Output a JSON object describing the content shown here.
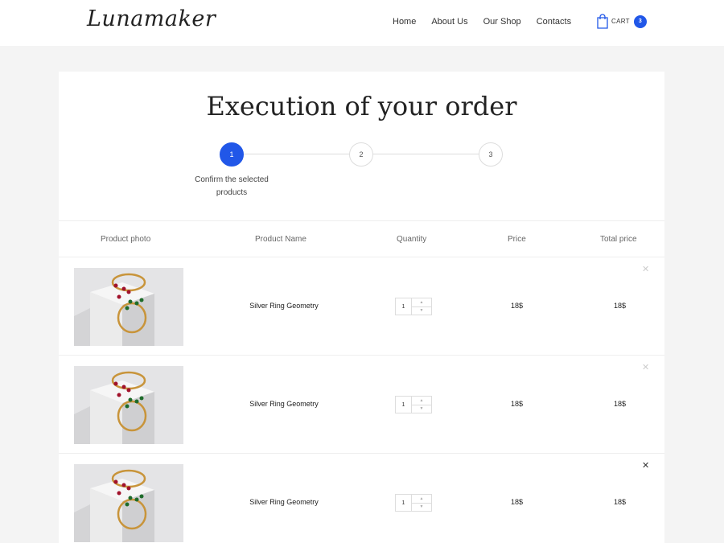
{
  "brand": {
    "logo": "Lunamaker"
  },
  "nav": {
    "items": [
      "Home",
      "About Us",
      "Our Shop",
      "Contacts"
    ]
  },
  "cart": {
    "label": "CART",
    "count": "3",
    "icon": "shopping-bag-icon"
  },
  "colors": {
    "accent": "#2157e8"
  },
  "page": {
    "title": "Execution of your order"
  },
  "steps": {
    "items": [
      "1",
      "2",
      "3"
    ],
    "active": 1,
    "caption_line1": "Confirm the selected",
    "caption_line2": "products"
  },
  "table": {
    "headers": [
      "Product photo",
      "Product Name",
      "Quantity",
      "Price",
      "Total price"
    ],
    "rows": [
      {
        "name": "Silver Ring Geometry",
        "qty": "1",
        "price": "18$",
        "total": "18$"
      },
      {
        "name": "Silver Ring Geometry",
        "qty": "1",
        "price": "18$",
        "total": "18$"
      },
      {
        "name": "Silver Ring Geometry",
        "qty": "1",
        "price": "18$",
        "total": "18$"
      }
    ]
  }
}
